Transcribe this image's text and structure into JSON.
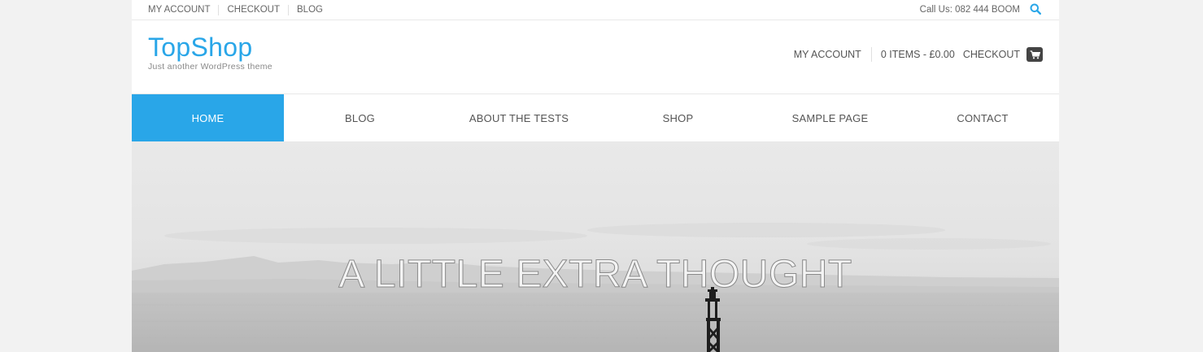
{
  "topbar": {
    "links": [
      "MY ACCOUNT",
      "CHECKOUT",
      "BLOG"
    ],
    "phone": "Call Us: 082 444 BOOM"
  },
  "header": {
    "site_title": "TopShop",
    "tagline": "Just another WordPress theme",
    "account": "MY ACCOUNT",
    "cart_summary": "0 ITEMS - £0.00",
    "checkout": "CHECKOUT"
  },
  "nav": {
    "items": [
      "HOME",
      "BLOG",
      "ABOUT THE TESTS",
      "SHOP",
      "SAMPLE PAGE",
      "CONTACT"
    ],
    "active": "HOME"
  },
  "hero": {
    "title": "A LITTLE EXTRA THOUGHT"
  },
  "colors": {
    "accent": "#29a6e8",
    "page_bg": "#f2f2f2"
  },
  "icons": [
    "search-icon",
    "cart-icon"
  ]
}
